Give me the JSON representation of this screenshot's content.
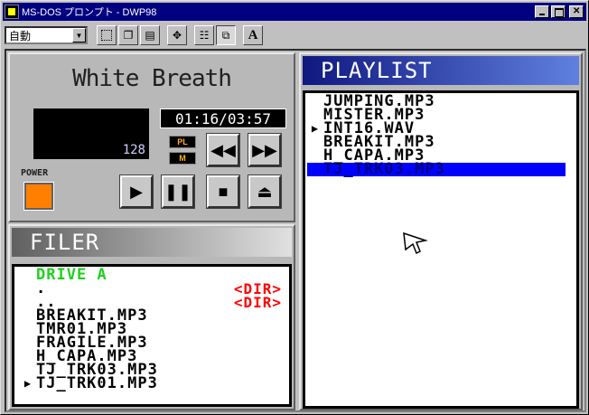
{
  "window": {
    "title": "MS-DOS プロンプト - DWP98"
  },
  "toolbar": {
    "font_select": "自動",
    "bold_label": "A"
  },
  "player": {
    "song_title": "White Breath",
    "bitrate": "128",
    "time": "01:16/03:57",
    "pl_label": "PL",
    "m_label": "M",
    "power_label": "POWER"
  },
  "filer": {
    "title": "FILER",
    "items": [
      {
        "mark": "",
        "name": "DRIVE A",
        "tag": ""
      },
      {
        "mark": "",
        "name": ".",
        "tag": "<DIR>"
      },
      {
        "mark": "",
        "name": "..",
        "tag": "<DIR>"
      },
      {
        "mark": "",
        "name": "BREAKIT.MP3",
        "tag": ""
      },
      {
        "mark": "",
        "name": "TMR01.MP3",
        "tag": ""
      },
      {
        "mark": "",
        "name": "FRAGILE.MP3",
        "tag": ""
      },
      {
        "mark": "",
        "name": "H_CAPA.MP3",
        "tag": ""
      },
      {
        "mark": "",
        "name": "TJ_TRK03.MP3",
        "tag": ""
      },
      {
        "mark": "▶",
        "name": "TJ_TRK01.MP3",
        "tag": ""
      }
    ]
  },
  "playlist": {
    "title": "PLAYLIST",
    "items": [
      {
        "mark": "",
        "name": "JUMPING.MP3"
      },
      {
        "mark": "",
        "name": "MISTER.MP3"
      },
      {
        "mark": "▶",
        "name": "INT16.WAV"
      },
      {
        "mark": "",
        "name": "BREAKIT.MP3"
      },
      {
        "mark": "",
        "name": "H_CAPA.MP3"
      },
      {
        "mark": "",
        "name": "TJ_TRK03.MP3"
      }
    ]
  },
  "colors": {
    "accent": "#ff8000",
    "selection": "#0000ff",
    "drive": "#20d020",
    "dir": "#ff0000"
  }
}
